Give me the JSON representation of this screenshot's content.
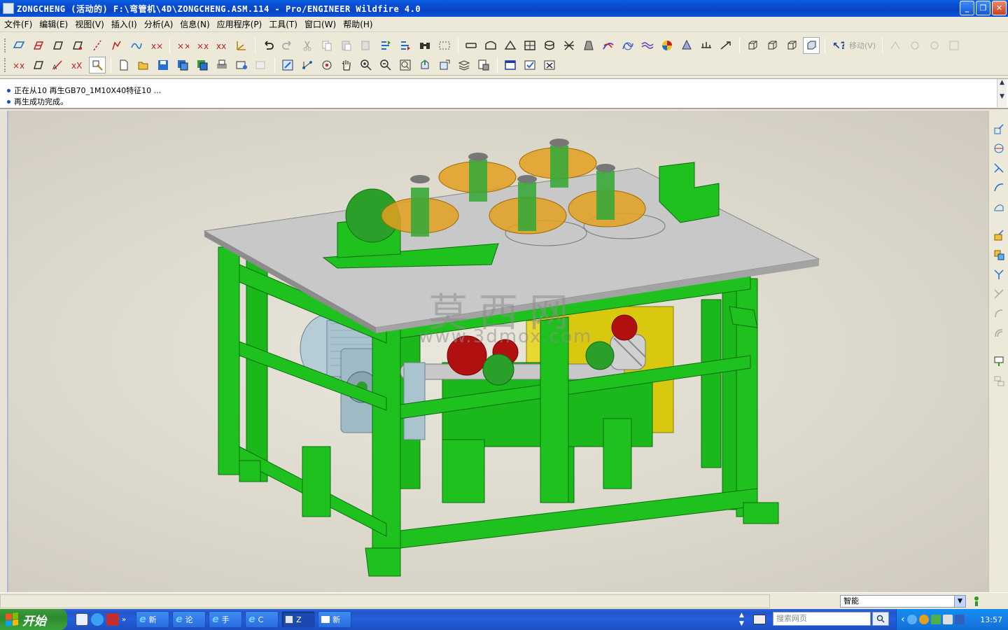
{
  "window": {
    "title": "ZONGCHENG (活动的) F:\\弯管机\\4D\\ZONGCHENG.ASM.114 - Pro/ENGINEER Wildfire 4.0",
    "minimize": "_",
    "maximize": "❐",
    "close": "✕"
  },
  "menu": [
    {
      "label": "文件(F)"
    },
    {
      "label": "编辑(E)"
    },
    {
      "label": "视图(V)"
    },
    {
      "label": "插入(I)"
    },
    {
      "label": "分析(A)"
    },
    {
      "label": "信息(N)"
    },
    {
      "label": "应用程序(P)"
    },
    {
      "label": "工具(T)"
    },
    {
      "label": "窗口(W)"
    },
    {
      "label": "帮助(H)"
    }
  ],
  "toolbar": {
    "move_label": "移动(V)"
  },
  "messages": [
    "正在从10 再生GB70_1M10X40特征10 ...",
    "再生成功完成。"
  ],
  "watermark": {
    "cn": "莫西网",
    "url": "www.3dmox.com"
  },
  "status": {
    "filter_value": "智能"
  },
  "taskbar": {
    "start_label": "开始",
    "tasks": [
      {
        "label": "新",
        "kind": "ie"
      },
      {
        "label": "论",
        "kind": "ie"
      },
      {
        "label": "手",
        "kind": "ie"
      },
      {
        "label": "C",
        "kind": "ie"
      },
      {
        "label": "Z",
        "kind": "proe"
      },
      {
        "label": "新",
        "kind": "doc"
      }
    ],
    "search_placeholder": "搜索网页",
    "clock": "13:57"
  },
  "colors": {
    "frame_green": "#1fc11f",
    "table_top": "#b9b9b9",
    "roller_orange": "#e3a020",
    "motor_blue": "#a9c3cf",
    "gearbox_yellow": "#d8c810",
    "gear_red": "#b01010"
  }
}
